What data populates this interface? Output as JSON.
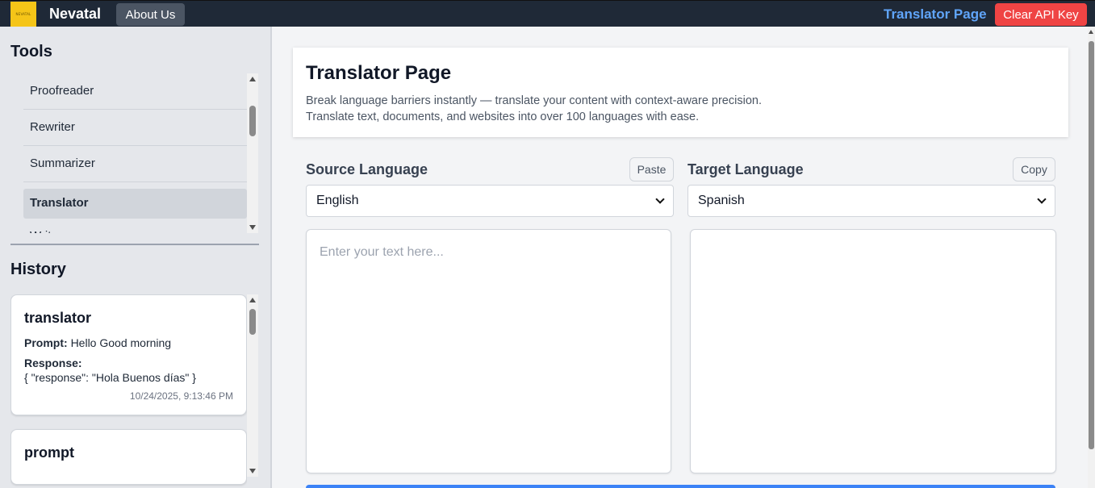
{
  "topbar": {
    "logo_text": "NEVATAL",
    "brand": "Nevatal",
    "about_label": "About Us",
    "current_page": "Translator Page",
    "clear_api_label": "Clear API Key"
  },
  "sidebar": {
    "tools_heading": "Tools",
    "tools": [
      {
        "label": "Proofreader",
        "active": false
      },
      {
        "label": "Rewriter",
        "active": false
      },
      {
        "label": "Summarizer",
        "active": false
      },
      {
        "label": "Translator",
        "active": true
      },
      {
        "label": "Writer",
        "active": false
      }
    ],
    "history_heading": "History",
    "history": [
      {
        "title": "translator",
        "prompt_label": "Prompt:",
        "prompt": "Hello Good morning",
        "response_label": "Response:",
        "response": "{ \"response\": \"Hola Buenos días\" }",
        "timestamp": "10/24/2025, 9:13:46 PM"
      },
      {
        "title": "prompt"
      }
    ]
  },
  "main": {
    "title": "Translator Page",
    "description_1": "Break language barriers instantly — translate your content with context-aware precision.",
    "description_2": "Translate text, documents, and websites into over 100 languages with ease.",
    "source_label": "Source Language",
    "paste_label": "Paste",
    "source_value": "English",
    "target_label": "Target Language",
    "copy_label": "Copy",
    "target_value": "Spanish",
    "input_placeholder": "Enter your text here...",
    "output_text": ""
  }
}
